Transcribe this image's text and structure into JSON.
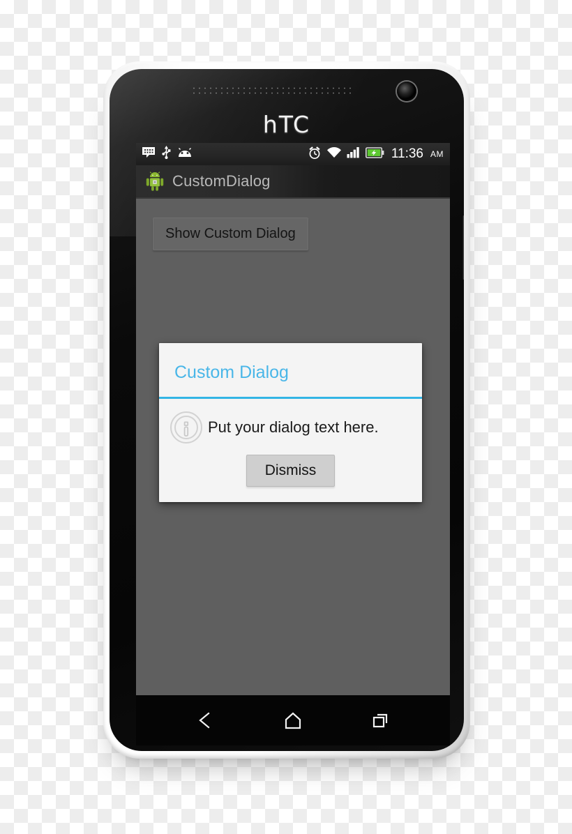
{
  "device": {
    "brand_logo": "hTC",
    "hardware": {
      "speaker_grille": "speaker-grille",
      "front_camera": "front-camera-lens",
      "side_button": "power-button"
    }
  },
  "status_bar": {
    "left_icons": [
      {
        "name": "messaging-icon",
        "label": "Messaging notification"
      },
      {
        "name": "usb-icon",
        "label": "USB connected"
      },
      {
        "name": "android-system-icon",
        "label": "Android system"
      }
    ],
    "right_icons": [
      {
        "name": "alarm-icon",
        "label": "Alarm set"
      },
      {
        "name": "wifi-icon",
        "label": "Wi-Fi connected"
      },
      {
        "name": "signal-icon",
        "label": "Cellular signal full"
      },
      {
        "name": "battery-charging-icon",
        "label": "Battery charging"
      }
    ],
    "clock": "11:36",
    "clock_period": "AM",
    "battery_color": "#5ec832"
  },
  "action_bar": {
    "app_icon": "android-robot-icon",
    "title": "CustomDialog"
  },
  "content": {
    "background_color": "#5f5f5f",
    "show_dialog_button": "Show Custom Dialog"
  },
  "dialog": {
    "title": "Custom Dialog",
    "title_color": "#49b6e8",
    "divider_color": "#33b5e5",
    "icon": "info-icon",
    "message": "Put your dialog text here.",
    "dismiss_button": "Dismiss",
    "background_color": "#f4f4f4"
  },
  "nav_bar": {
    "buttons": [
      {
        "name": "back-button",
        "label": "Back"
      },
      {
        "name": "home-button",
        "label": "Home"
      },
      {
        "name": "recent-apps-button",
        "label": "Recent apps"
      }
    ]
  }
}
